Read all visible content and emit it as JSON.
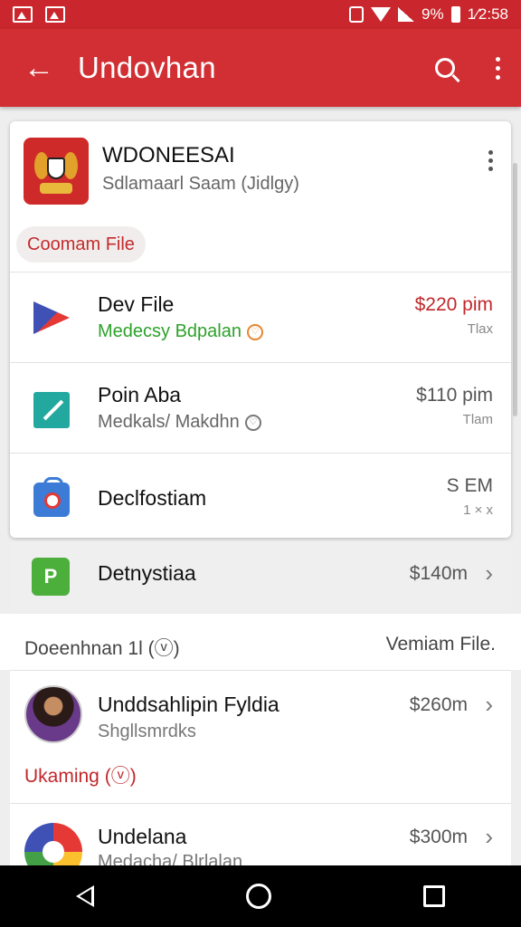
{
  "status_bar": {
    "battery": "9%",
    "time": "1⁄2:58"
  },
  "app_bar": {
    "title": "Undovhan"
  },
  "card": {
    "title": "WDONEESAI",
    "subtitle": "Sdlamaarl Saam (Jidlgy)",
    "chip": "Coomam File",
    "rows": [
      {
        "title": "Dev File",
        "subtitle": "Medecsy Bdpalan",
        "price": "$220 pim",
        "meta": "Tlax"
      },
      {
        "title": "Poin Aba",
        "subtitle": "Medkals/ Makdhn",
        "price": "$110 pim",
        "meta": "Tlam"
      },
      {
        "title": "Declfostiam",
        "subtitle": "",
        "price": "S EM",
        "meta": "1 × x"
      }
    ]
  },
  "standalone": {
    "title": "Detnystiaa",
    "price": "$140m"
  },
  "section": {
    "left": "Doeenhnan 1l (ⓥ)",
    "right": "Vemiam File."
  },
  "list2": {
    "item1": {
      "title": "Unddsahlipin Fyldia",
      "subtitle": "Shgllsmrdks",
      "price": "$260m"
    },
    "upcoming": "Ukaming (ⓥ)",
    "item2": {
      "title": "Undelana",
      "subtitle": "Medacha/ Blrlalan",
      "price": "$300m"
    }
  },
  "colors": {
    "primary": "#d12f33",
    "accent_red": "#c0282b",
    "green": "#2da22a"
  }
}
